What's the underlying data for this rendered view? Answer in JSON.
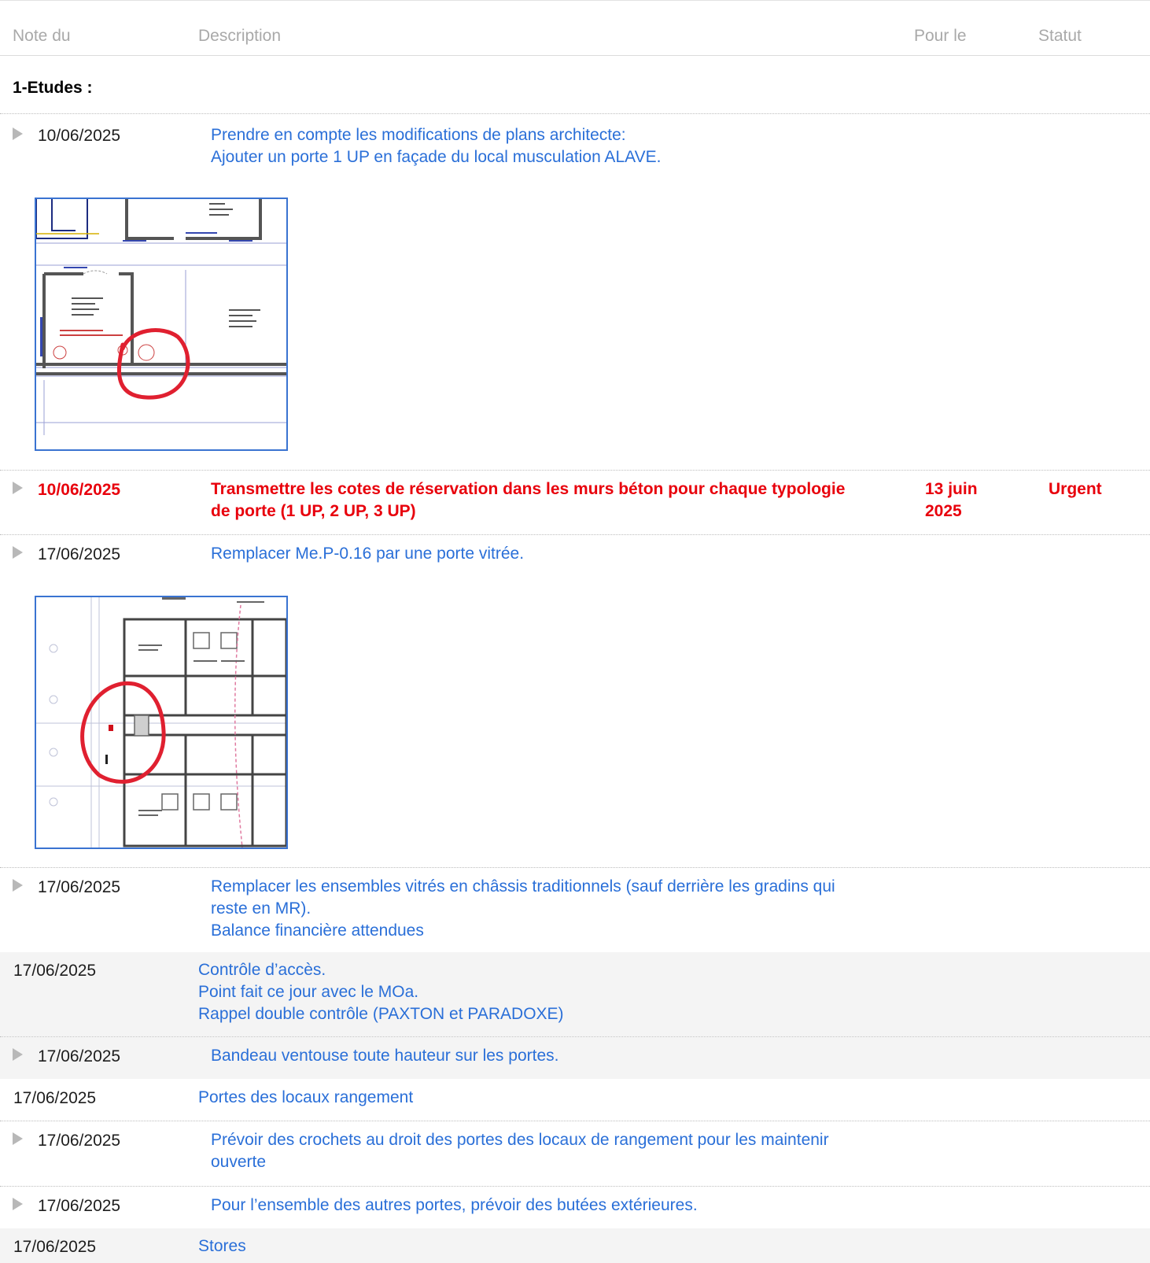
{
  "header": {
    "col_date": "Note du",
    "col_desc": "Description",
    "col_due": "Pour le",
    "col_status": "Statut"
  },
  "section": {
    "title": "1-Etudes :"
  },
  "rows": [
    {
      "date": "10/06/2025",
      "desc": "Prendre en compte les modifications de plans architecte:\nAjouter un porte 1 UP en façade du local musculation ALAVE.",
      "attachment": "floor-plan-thumbnail"
    },
    {
      "date": "10/06/2025",
      "desc": "Transmettre les cotes de réservation dans les murs béton pour chaque typologie\nde porte (1 UP, 2 UP, 3 UP)",
      "due": "13 juin\n2025",
      "status": "Urgent",
      "urgent": true,
      "color": "#e8000c"
    },
    {
      "date": "17/06/2025",
      "desc": "Remplacer Me.P-0.16 par une porte vitrée.",
      "attachment": "floor-plan-thumbnail"
    },
    {
      "date": "17/06/2025",
      "desc": "Remplacer les ensembles vitrés en châssis traditionnels (sauf derrière les gradins qui\nreste en MR).\nBalance financière attendues"
    },
    {
      "date": "17/06/2025",
      "desc": "Contrôle d’accès.\nPoint fait ce jour avec le MOa.\nRappel double contrôle (PAXTON et PARADOXE)"
    },
    {
      "date": "17/06/2025",
      "desc": "Bandeau ventouse toute hauteur sur les portes."
    },
    {
      "date": "17/06/2025",
      "desc": "Portes des locaux rangement"
    },
    {
      "date": "17/06/2025",
      "desc": "Prévoir des crochets au droit des portes des locaux de rangement pour les maintenir\nouverte"
    },
    {
      "date": "17/06/2025",
      "desc": "Pour l’ensemble des autres portes, prévoir des butées extérieures."
    },
    {
      "date": "17/06/2025",
      "desc": "Stores"
    }
  ],
  "colors": {
    "link_blue": "#2a6fd8",
    "urgent_red": "#e8000c",
    "header_grey": "#a9a9a9",
    "thumb_border": "#3a73d1"
  }
}
